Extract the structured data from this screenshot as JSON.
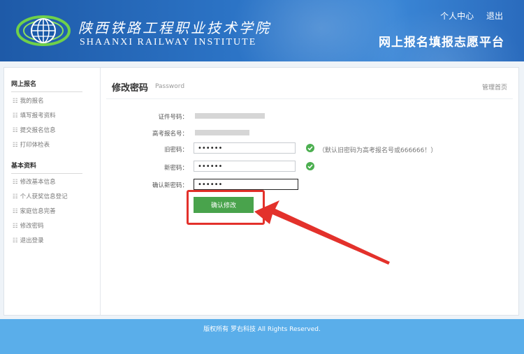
{
  "header": {
    "brand_cn": "陕西铁路工程职业技术学院",
    "brand_en": "SHAANXI RAILWAY INSTITUTE",
    "links": {
      "user_center": "个人中心",
      "logout": "退出"
    },
    "platform_title": "网上报名填报志愿平台",
    "logo_icon": "globe-logo-icon"
  },
  "sidebar": {
    "sections": [
      {
        "title": "网上报名",
        "items": [
          "我的报名",
          "填写报考资料",
          "提交报名信息",
          "打印体检表"
        ]
      },
      {
        "title": "基本资料",
        "items": [
          "修改基本信息",
          "个人获奖信息登记",
          "家庭信息完善",
          "修改密码",
          "退出登录"
        ]
      }
    ],
    "item_icon": "list-icon"
  },
  "page": {
    "title": "修改密码",
    "subtitle": "Password",
    "home_link": "管理首页"
  },
  "form": {
    "id_label": "证件号码：",
    "exam_no_label": "高考报名号：",
    "old_pw_label": "旧密码：",
    "old_pw_value": "••••••",
    "old_pw_hint": "（默认旧密码为高考报名号或666666！）",
    "new_pw_label": "新密码：",
    "new_pw_value": "••••••",
    "confirm_pw_label": "确认新密码：",
    "confirm_pw_value": "••••••",
    "submit_label": "确认修改",
    "valid_icon": "check-circle-icon"
  },
  "footer": {
    "copyright": "版权所有 罗右科技 All Rights Reserved."
  },
  "colors": {
    "header_blue": "#2c74c6",
    "footer_blue": "#5aaeea",
    "button_green": "#49a34c",
    "check_green": "#4caf50",
    "annotation_red": "#e3312b"
  }
}
